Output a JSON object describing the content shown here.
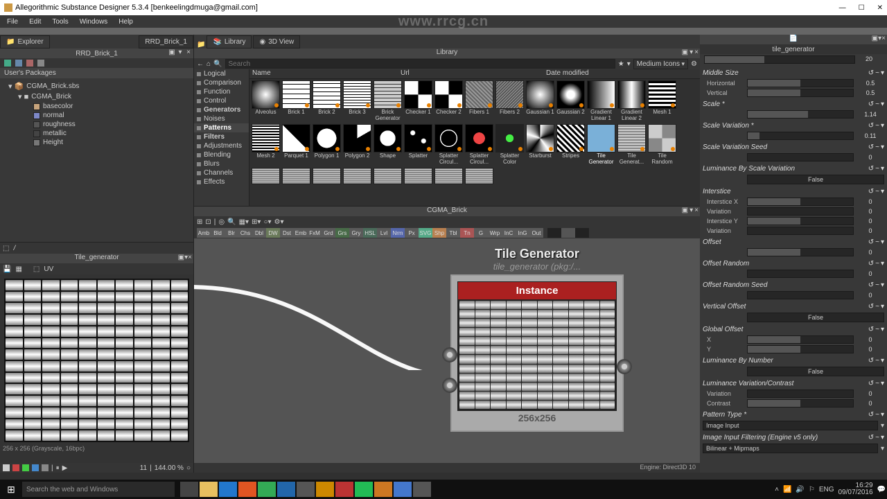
{
  "app": {
    "title": "Allegorithmic Substance Designer 5.3.4 [benkeelingdmuga@gmail.com]",
    "menus": [
      "File",
      "Edit",
      "Tools",
      "Windows",
      "Help"
    ]
  },
  "watermark": "www.rrcg.cn",
  "explorer": {
    "tab_label": "Explorer",
    "panel_title": "RRD_Brick_1",
    "packages_hdr": "User's Packages",
    "root": "CGMA_Brick.sbs",
    "graph": "CGMA_Brick",
    "outputs": [
      "basecolor",
      "normal",
      "roughness",
      "metallic",
      "Height"
    ],
    "swatches": [
      "#c7a47c",
      "#7d88c8",
      "#555",
      "#444",
      "#777"
    ]
  },
  "preview2d": {
    "title": "Tile_generator",
    "status": "256 x 256 (Grayscale, 16bpc)",
    "zoom_spacing": "11",
    "zoom_pct": "144.00 %"
  },
  "library": {
    "tab1": "Library",
    "tab2": "3D View",
    "panel_title": "Library",
    "search_ph": "Search",
    "mode_label": "Medium Icons",
    "columns": [
      "Name",
      "Url",
      "Date modified"
    ],
    "categories": [
      "Logical",
      "Comparison",
      "Function",
      "Control",
      "Generators",
      "Noises",
      "Patterns",
      "Filters",
      "Adjustments",
      "Blending",
      "Blurs",
      "Channels",
      "Effects"
    ],
    "cat_sel": "Patterns",
    "cat_groups": [
      "Generators",
      "Filters"
    ],
    "row1": [
      "Alveolus",
      "Brick 1",
      "Brick 2",
      "Brick 3",
      "Brick Generator",
      "Checker 1",
      "Checker 2",
      "Fibers 1",
      "Fibers 2",
      "Gaussian 1",
      "Gaussian 2",
      "Gradient Linear 1",
      "Gradient Linear 2",
      "Mesh 1"
    ],
    "row2": [
      "Mesh 2",
      "Parquet 1",
      "Polygon 1",
      "Polygon 2",
      "Shape",
      "Splatter",
      "Splatter Circul...",
      "Splatter Circul...",
      "Splatter Color",
      "Starburst",
      "Stripes",
      "Tile Generator",
      "Tile Generat...",
      "Tile Random"
    ],
    "sel_thumb": "Tile Generator",
    "row3_count": 8
  },
  "graph": {
    "title": "CGMA_Brick",
    "chips": [
      "Amb",
      "Bld",
      "Blr",
      "Chs",
      "Dbl",
      "DW",
      "Dst",
      "Emb",
      "FxM",
      "Grd",
      "Grs",
      "Gry",
      "HSL",
      "Lvl",
      "Nrm",
      "Px",
      "SVG",
      "Shp",
      "Tbl",
      "Tn",
      "G",
      "Wrp",
      "InC",
      "InG",
      "Out"
    ],
    "chip_colors": [
      "#5a5a5a",
      "#5a5a5a",
      "#5a5a5a",
      "#5a5a5a",
      "#5a5a5a",
      "#6a7a5a",
      "#5a5a5a",
      "#5a5a5a",
      "#5a5a5a",
      "#5a5a5a",
      "#486b48",
      "#5a5a5a",
      "#4a6b5a",
      "#5a5a5a",
      "#5566aa",
      "#5a5a5a",
      "#55aa88",
      "#b88050",
      "#5a5a5a",
      "#aa5555",
      "#5a5a5a",
      "#5a5a5a",
      "#5a5a5a",
      "#5a5a5a",
      "#5a5a5a"
    ],
    "node_title": "Tile Generator",
    "node_sub": "tile_generator (pkg:/...",
    "node_label": "Instance",
    "node_size": "256x256",
    "footer": "Engine: Direct3D 10"
  },
  "props": {
    "title": "tile_generator",
    "title_val": "20",
    "sections": [
      {
        "label": "Middle Size",
        "fields": [
          {
            "lbl": "Horizontal",
            "val": "0.5",
            "pos": 50
          },
          {
            "lbl": "Vertical",
            "val": "0.5",
            "pos": 50
          }
        ]
      },
      {
        "label": "Scale *",
        "fields": [
          {
            "lbl": "",
            "val": "1.14",
            "pos": 57
          }
        ]
      },
      {
        "label": "Scale Variation *",
        "fields": [
          {
            "lbl": "",
            "val": "0.11",
            "pos": 11
          }
        ]
      },
      {
        "label": "Scale Variation Seed",
        "fields": [
          {
            "lbl": "",
            "val": "0",
            "pos": 0
          }
        ]
      },
      {
        "label": "Luminance By Scale Variation",
        "bool": "False"
      },
      {
        "label": "Interstice",
        "fields": [
          {
            "lbl": "Interstice X",
            "val": "0",
            "pos": 50
          },
          {
            "lbl": "Variation",
            "val": "0",
            "pos": 0
          },
          {
            "lbl": "Interstice Y",
            "val": "0",
            "pos": 50
          },
          {
            "lbl": "Variation",
            "val": "0",
            "pos": 0
          }
        ]
      },
      {
        "label": "Offset",
        "fields": [
          {
            "lbl": "",
            "val": "0",
            "pos": 50
          }
        ]
      },
      {
        "label": "Offset Random",
        "fields": [
          {
            "lbl": "",
            "val": "0",
            "pos": 0
          }
        ]
      },
      {
        "label": "Offset Random Seed",
        "fields": [
          {
            "lbl": "",
            "val": "0",
            "pos": 0
          }
        ]
      },
      {
        "label": "Vertical Offset",
        "bool": "False"
      },
      {
        "label": "Global Offset",
        "fields": [
          {
            "lbl": "X",
            "val": "0",
            "pos": 50
          },
          {
            "lbl": "Y",
            "val": "0",
            "pos": 50
          }
        ]
      },
      {
        "label": "Luminance By Number",
        "bool": "False"
      },
      {
        "label": "Luminance Variation/Contrast",
        "fields": [
          {
            "lbl": "Variation",
            "val": "0",
            "pos": 0
          },
          {
            "lbl": "Contrast",
            "val": "0",
            "pos": 50
          }
        ]
      },
      {
        "label": "Pattern Type *",
        "combo": "Image Input"
      },
      {
        "label": "Image Input Filtering (Engine v5 only)",
        "combo": "Bilinear + Mipmaps"
      }
    ]
  },
  "taskbar": {
    "search_ph": "Search the web and Windows",
    "lang": "ENG",
    "time": "16:29",
    "date": "09/07/2016"
  }
}
